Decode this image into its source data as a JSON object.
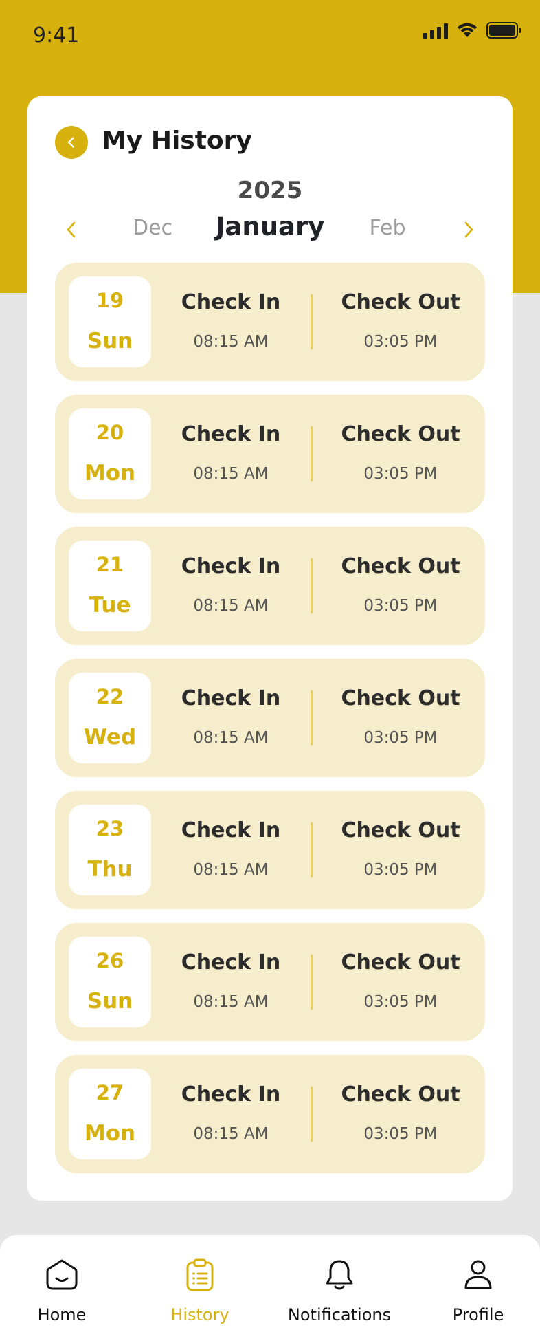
{
  "status_bar": {
    "time": "9:41"
  },
  "header": {
    "title": "My History"
  },
  "calendar": {
    "year": "2025",
    "prev_month": "Dec",
    "current_month": "January",
    "next_month": "Feb"
  },
  "history": [
    {
      "date": "19",
      "day": "Sun",
      "checkin_label": "Check In",
      "checkin_time": "08:15 AM",
      "checkout_label": "Check Out",
      "checkout_time": "03:05 PM"
    },
    {
      "date": "20",
      "day": "Mon",
      "checkin_label": "Check In",
      "checkin_time": "08:15 AM",
      "checkout_label": "Check Out",
      "checkout_time": "03:05 PM"
    },
    {
      "date": "21",
      "day": "Tue",
      "checkin_label": "Check In",
      "checkin_time": "08:15 AM",
      "checkout_label": "Check Out",
      "checkout_time": "03:05 PM"
    },
    {
      "date": "22",
      "day": "Wed",
      "checkin_label": "Check In",
      "checkin_time": "08:15 AM",
      "checkout_label": "Check Out",
      "checkout_time": "03:05 PM"
    },
    {
      "date": "23",
      "day": "Thu",
      "checkin_label": "Check In",
      "checkin_time": "08:15 AM",
      "checkout_label": "Check Out",
      "checkout_time": "03:05 PM"
    },
    {
      "date": "26",
      "day": "Sun",
      "checkin_label": "Check In",
      "checkin_time": "08:15 AM",
      "checkout_label": "Check Out",
      "checkout_time": "03:05 PM"
    },
    {
      "date": "27",
      "day": "Mon",
      "checkin_label": "Check In",
      "checkin_time": "08:15 AM",
      "checkout_label": "Check Out",
      "checkout_time": "03:05 PM"
    }
  ],
  "bottom_nav": {
    "items": [
      {
        "label": "Home",
        "icon": "home-icon"
      },
      {
        "label": "History",
        "icon": "clipboard-icon",
        "active": true
      },
      {
        "label": "Notifications",
        "icon": "bell-icon"
      },
      {
        "label": "Profile",
        "icon": "user-icon"
      }
    ]
  },
  "colors": {
    "accent": "#D7B10E",
    "row_bg": "#F6EDCC",
    "page_bg": "#E6E6E6",
    "card_bg": "#FFFFFF"
  }
}
